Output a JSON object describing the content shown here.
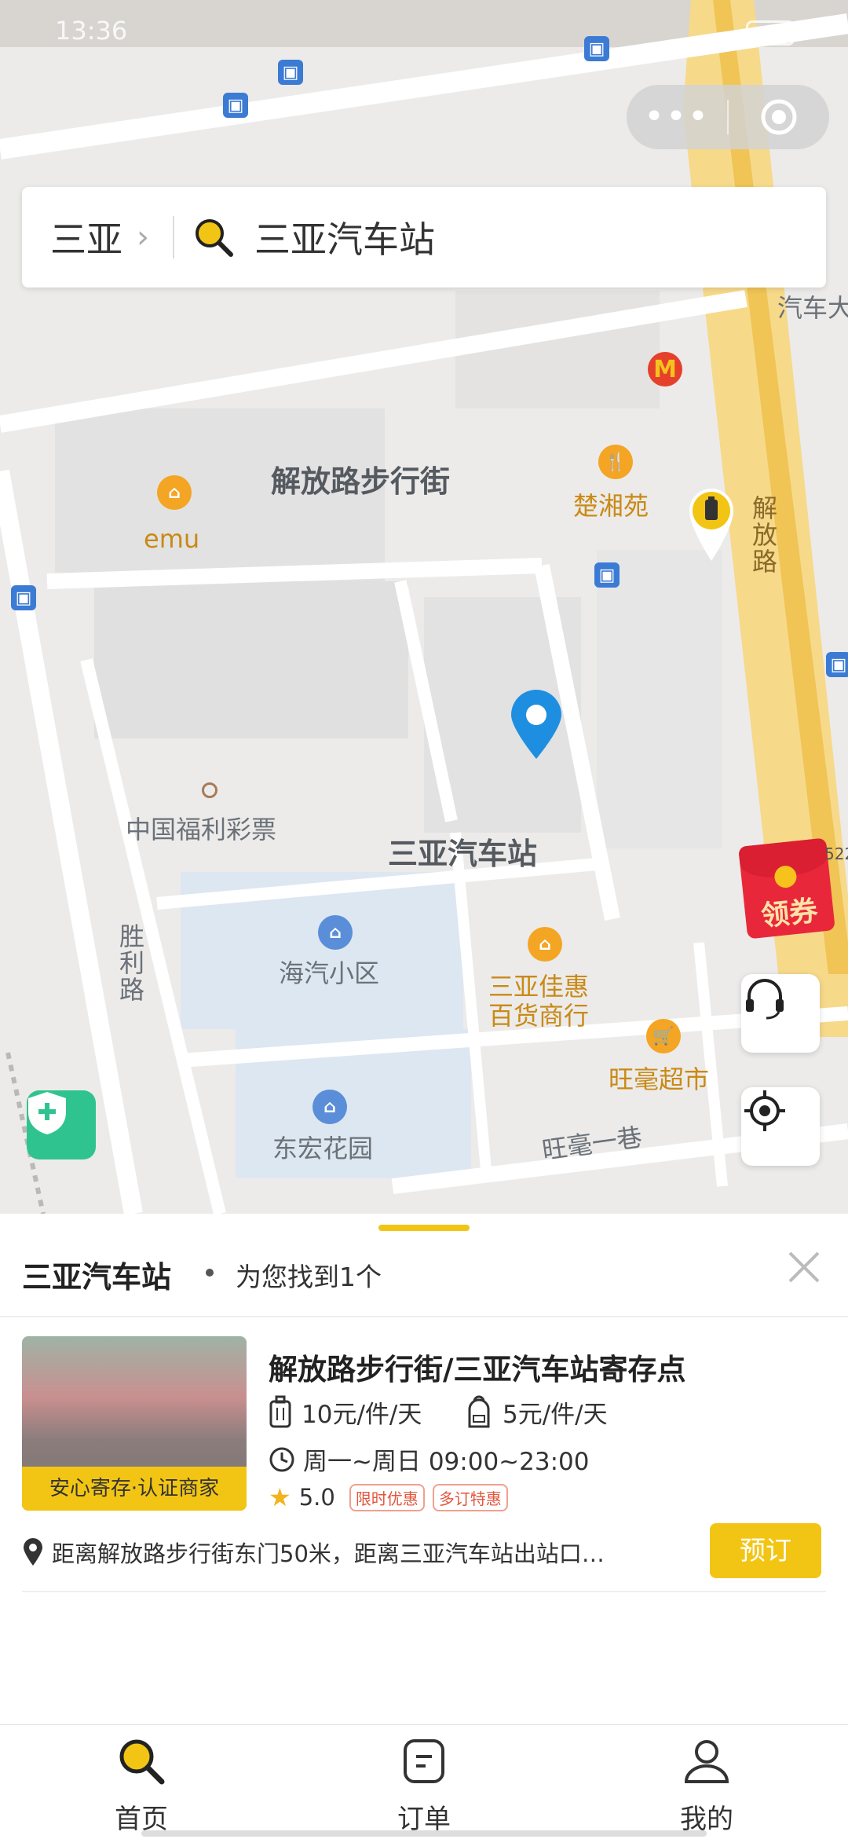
{
  "status_bar": {
    "time": "13:36"
  },
  "search": {
    "city": "三亚",
    "query": "三亚汽车站"
  },
  "map": {
    "labels": {
      "street_main": "解放路步行街",
      "emu": "emu",
      "chuxiangyuan": "楚湘苑",
      "jiefang_road": "解放路",
      "lottery": "中国福利彩票",
      "station": "三亚汽车站",
      "shengli_road": "胜利路",
      "haiqi": "海汽小区",
      "jiahui": "三亚佳惠\n百货商行",
      "wanghao": "旺毫超市",
      "donghong": "东宏花园",
      "wanghao_lane": "旺毫一巷",
      "road_top_right": "汽车大",
      "coupon": "领券",
      "coupon_corner": "522"
    }
  },
  "panel": {
    "location_name": "三亚汽车站",
    "result_summary": "为您找到1个",
    "result": {
      "title": "解放路步行街/三亚汽车站寄存点",
      "price_luggage": "10元/件/天",
      "price_backpack": "5元/件/天",
      "hours": "周一~周日 09:00~23:00",
      "rating": "5.0",
      "tag1": "限时优惠",
      "tag2": "多订特惠",
      "badge": "安心寄存·认证商家",
      "address": "距离解放路步行街东门50米，距离三亚汽车站出站口…",
      "book_button": "预订"
    }
  },
  "tabs": [
    {
      "label": "首页",
      "active": true
    },
    {
      "label": "订单",
      "active": false
    },
    {
      "label": "我的",
      "active": false
    }
  ],
  "colors": {
    "accent": "#f2c514",
    "pin": "#1e8fe0",
    "coupon": "#e8283a"
  }
}
